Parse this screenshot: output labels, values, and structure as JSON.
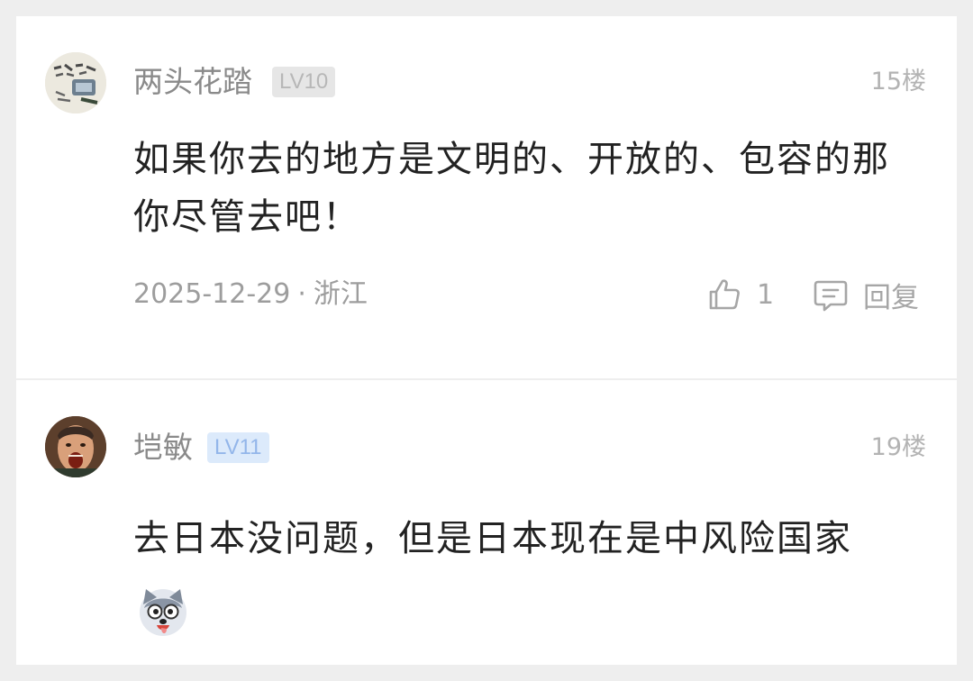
{
  "comments": [
    {
      "username": "两头花踏",
      "level": "LV10",
      "floor": "15楼",
      "content": "如果你去的地方是文明的、开放的、包容的那你尽管去吧！",
      "date": "2025-12-29",
      "separator": "·",
      "location": "浙江",
      "likes": "1",
      "reply_label": "回复",
      "level_color": "#b7b7b7"
    },
    {
      "username": "垲敏",
      "level": "LV11",
      "floor": "19楼",
      "content": "去日本没问题，但是日本现在是中风险国家",
      "emoji": "husky-emoji",
      "level_color": "#93b6ea"
    }
  ],
  "icons": {
    "like": "thumbs-up-icon",
    "reply": "comment-bubble-icon"
  }
}
